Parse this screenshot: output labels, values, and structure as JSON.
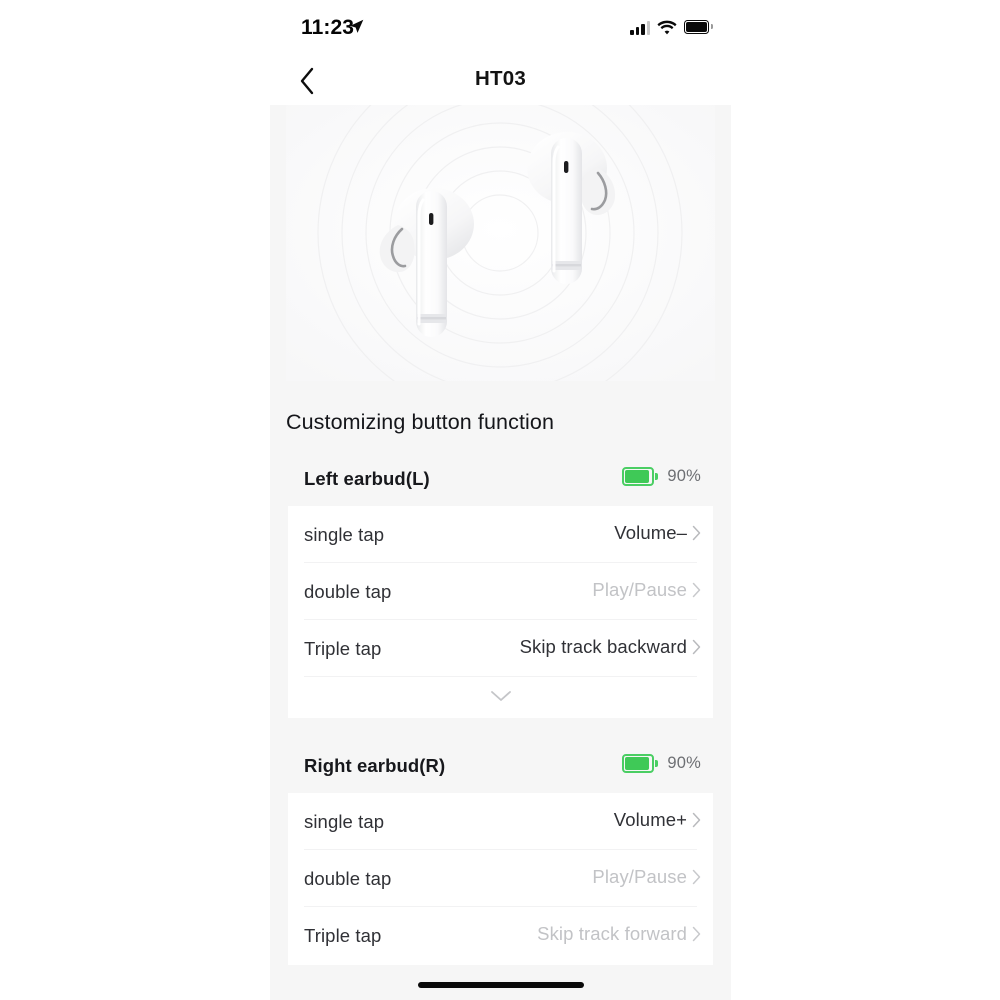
{
  "status_bar": {
    "time": "11:23",
    "location_icon": "location-arrow-icon",
    "signal_icon": "cellular-signal-icon",
    "wifi_icon": "wifi-icon",
    "battery_icon": "battery-full-icon"
  },
  "nav": {
    "back_icon": "chevron-left-icon",
    "title": "HT03"
  },
  "hero": {
    "image_alt": "wireless-earbuds-product-image"
  },
  "main": {
    "heading": "Customizing button function",
    "expand_icon": "chevron-down-icon",
    "chevron_icon": "chevron-right-icon",
    "battery_color": "#3fc957",
    "sections": [
      {
        "name": "Left earbud(L)",
        "battery": "90%",
        "expandable": true,
        "rows": [
          {
            "label": "single tap",
            "value": "Volume–",
            "dim": false
          },
          {
            "label": "double tap",
            "value": "Play/Pause",
            "dim": true
          },
          {
            "label": "Triple tap",
            "value": "Skip track backward",
            "dim": false
          }
        ]
      },
      {
        "name": "Right earbud(R)",
        "battery": "90%",
        "expandable": false,
        "rows": [
          {
            "label": "single tap",
            "value": "Volume+",
            "dim": false
          },
          {
            "label": "double tap",
            "value": "Play/Pause",
            "dim": true
          },
          {
            "label": "Triple tap",
            "value": "Skip track forward",
            "dim": true
          }
        ]
      }
    ]
  }
}
